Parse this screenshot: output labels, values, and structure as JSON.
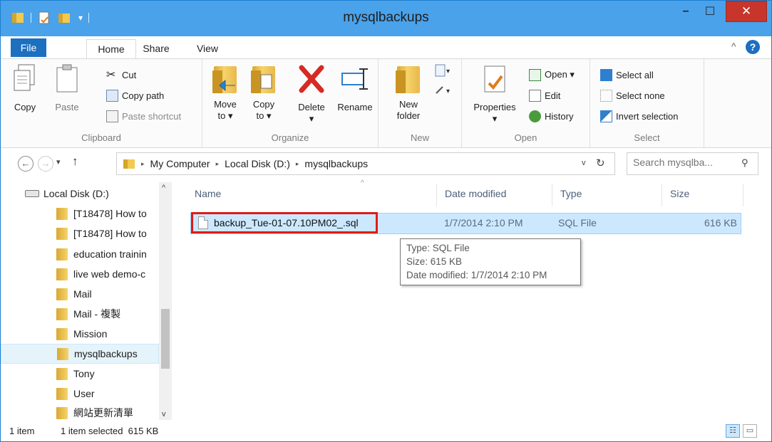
{
  "window": {
    "title": "mysqlbackups",
    "minimize": "–",
    "maximize": "☐",
    "close": "✕"
  },
  "ribbon": {
    "tabs": [
      "File",
      "Home",
      "Share",
      "View"
    ],
    "collapse": "^",
    "help": "?",
    "groups": {
      "clipboard": {
        "label": "Clipboard",
        "copy": "Copy",
        "paste": "Paste",
        "cut": "Cut",
        "copy_path": "Copy path",
        "paste_shortcut": "Paste shortcut"
      },
      "organize": {
        "label": "Organize",
        "move_to": "Move",
        "move_to_2": "to ▾",
        "copy_to": "Copy",
        "copy_to_2": "to ▾",
        "delete": "Delete",
        "delete_2": "▾",
        "rename": "Rename"
      },
      "new": {
        "label": "New",
        "new_folder": "New",
        "new_folder_2": "folder"
      },
      "open": {
        "label": "Open",
        "properties": "Properties",
        "properties_2": "▾",
        "open": "Open ▾",
        "edit": "Edit",
        "history": "History"
      },
      "select": {
        "label": "Select",
        "select_all": "Select all",
        "select_none": "Select none",
        "invert": "Invert selection"
      }
    }
  },
  "address": {
    "back": "←",
    "forward": "→",
    "recent": "▾",
    "up": "↑",
    "crumbs": [
      "My Computer",
      "Local Disk (D:)",
      "mysqlbackups"
    ],
    "crumb_sep": "▸",
    "dropdown": "v",
    "refresh": "↻",
    "search_placeholder": "Search mysqlba...",
    "search_icon": "⚲"
  },
  "nav": {
    "drive": "Local Disk (D:)",
    "items": [
      "[T18478] How to",
      "[T18478] How to",
      "education trainin",
      "live web demo-c",
      "Mail",
      "Mail - 複製",
      "Mission",
      "mysqlbackups",
      "Tony",
      "User",
      "網站更新清單"
    ],
    "scroll_up": "^",
    "scroll_down": "v"
  },
  "filelist": {
    "columns": {
      "name": "Name",
      "date": "Date modified",
      "type": "Type",
      "size": "Size"
    },
    "sort_arrow": "^",
    "files": [
      {
        "name": "backup_Tue-01-07.10PM02_.sql",
        "date": "1/7/2014 2:10 PM",
        "type": "SQL File",
        "size": "616 KB"
      }
    ],
    "tooltip": {
      "line1": "Type: SQL File",
      "line2": "Size: 615 KB",
      "line3": "Date modified: 1/7/2014 2:10 PM"
    }
  },
  "status": {
    "count": "1 item",
    "selection": "1 item selected  615 KB",
    "details_view": "☷",
    "icons_view": "▭"
  },
  "colors": {
    "titlebar": "#4aa2ea",
    "file_tab": "#1d6fc0",
    "close_button": "#c7352b",
    "selection": "#cce8ff",
    "highlight_border": "#e01b1b"
  }
}
